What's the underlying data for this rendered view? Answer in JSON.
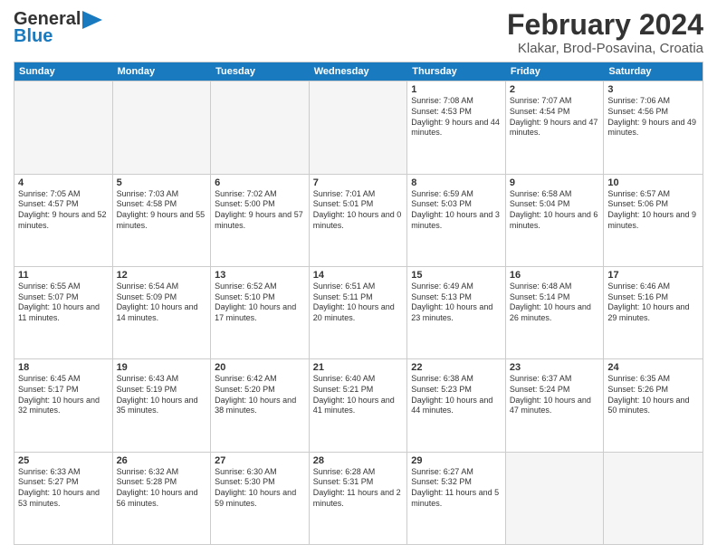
{
  "header": {
    "logo_line1": "General",
    "logo_line2": "Blue",
    "main_title": "February 2024",
    "sub_title": "Klakar, Brod-Posavina, Croatia"
  },
  "days_of_week": [
    "Sunday",
    "Monday",
    "Tuesday",
    "Wednesday",
    "Thursday",
    "Friday",
    "Saturday"
  ],
  "weeks": [
    [
      {
        "day": "",
        "info": ""
      },
      {
        "day": "",
        "info": ""
      },
      {
        "day": "",
        "info": ""
      },
      {
        "day": "",
        "info": ""
      },
      {
        "day": "1",
        "info": "Sunrise: 7:08 AM\nSunset: 4:53 PM\nDaylight: 9 hours\nand 44 minutes."
      },
      {
        "day": "2",
        "info": "Sunrise: 7:07 AM\nSunset: 4:54 PM\nDaylight: 9 hours\nand 47 minutes."
      },
      {
        "day": "3",
        "info": "Sunrise: 7:06 AM\nSunset: 4:56 PM\nDaylight: 9 hours\nand 49 minutes."
      }
    ],
    [
      {
        "day": "4",
        "info": "Sunrise: 7:05 AM\nSunset: 4:57 PM\nDaylight: 9 hours\nand 52 minutes."
      },
      {
        "day": "5",
        "info": "Sunrise: 7:03 AM\nSunset: 4:58 PM\nDaylight: 9 hours\nand 55 minutes."
      },
      {
        "day": "6",
        "info": "Sunrise: 7:02 AM\nSunset: 5:00 PM\nDaylight: 9 hours\nand 57 minutes."
      },
      {
        "day": "7",
        "info": "Sunrise: 7:01 AM\nSunset: 5:01 PM\nDaylight: 10 hours\nand 0 minutes."
      },
      {
        "day": "8",
        "info": "Sunrise: 6:59 AM\nSunset: 5:03 PM\nDaylight: 10 hours\nand 3 minutes."
      },
      {
        "day": "9",
        "info": "Sunrise: 6:58 AM\nSunset: 5:04 PM\nDaylight: 10 hours\nand 6 minutes."
      },
      {
        "day": "10",
        "info": "Sunrise: 6:57 AM\nSunset: 5:06 PM\nDaylight: 10 hours\nand 9 minutes."
      }
    ],
    [
      {
        "day": "11",
        "info": "Sunrise: 6:55 AM\nSunset: 5:07 PM\nDaylight: 10 hours\nand 11 minutes."
      },
      {
        "day": "12",
        "info": "Sunrise: 6:54 AM\nSunset: 5:09 PM\nDaylight: 10 hours\nand 14 minutes."
      },
      {
        "day": "13",
        "info": "Sunrise: 6:52 AM\nSunset: 5:10 PM\nDaylight: 10 hours\nand 17 minutes."
      },
      {
        "day": "14",
        "info": "Sunrise: 6:51 AM\nSunset: 5:11 PM\nDaylight: 10 hours\nand 20 minutes."
      },
      {
        "day": "15",
        "info": "Sunrise: 6:49 AM\nSunset: 5:13 PM\nDaylight: 10 hours\nand 23 minutes."
      },
      {
        "day": "16",
        "info": "Sunrise: 6:48 AM\nSunset: 5:14 PM\nDaylight: 10 hours\nand 26 minutes."
      },
      {
        "day": "17",
        "info": "Sunrise: 6:46 AM\nSunset: 5:16 PM\nDaylight: 10 hours\nand 29 minutes."
      }
    ],
    [
      {
        "day": "18",
        "info": "Sunrise: 6:45 AM\nSunset: 5:17 PM\nDaylight: 10 hours\nand 32 minutes."
      },
      {
        "day": "19",
        "info": "Sunrise: 6:43 AM\nSunset: 5:19 PM\nDaylight: 10 hours\nand 35 minutes."
      },
      {
        "day": "20",
        "info": "Sunrise: 6:42 AM\nSunset: 5:20 PM\nDaylight: 10 hours\nand 38 minutes."
      },
      {
        "day": "21",
        "info": "Sunrise: 6:40 AM\nSunset: 5:21 PM\nDaylight: 10 hours\nand 41 minutes."
      },
      {
        "day": "22",
        "info": "Sunrise: 6:38 AM\nSunset: 5:23 PM\nDaylight: 10 hours\nand 44 minutes."
      },
      {
        "day": "23",
        "info": "Sunrise: 6:37 AM\nSunset: 5:24 PM\nDaylight: 10 hours\nand 47 minutes."
      },
      {
        "day": "24",
        "info": "Sunrise: 6:35 AM\nSunset: 5:26 PM\nDaylight: 10 hours\nand 50 minutes."
      }
    ],
    [
      {
        "day": "25",
        "info": "Sunrise: 6:33 AM\nSunset: 5:27 PM\nDaylight: 10 hours\nand 53 minutes."
      },
      {
        "day": "26",
        "info": "Sunrise: 6:32 AM\nSunset: 5:28 PM\nDaylight: 10 hours\nand 56 minutes."
      },
      {
        "day": "27",
        "info": "Sunrise: 6:30 AM\nSunset: 5:30 PM\nDaylight: 10 hours\nand 59 minutes."
      },
      {
        "day": "28",
        "info": "Sunrise: 6:28 AM\nSunset: 5:31 PM\nDaylight: 11 hours\nand 2 minutes."
      },
      {
        "day": "29",
        "info": "Sunrise: 6:27 AM\nSunset: 5:32 PM\nDaylight: 11 hours\nand 5 minutes."
      },
      {
        "day": "",
        "info": ""
      },
      {
        "day": "",
        "info": ""
      }
    ]
  ]
}
